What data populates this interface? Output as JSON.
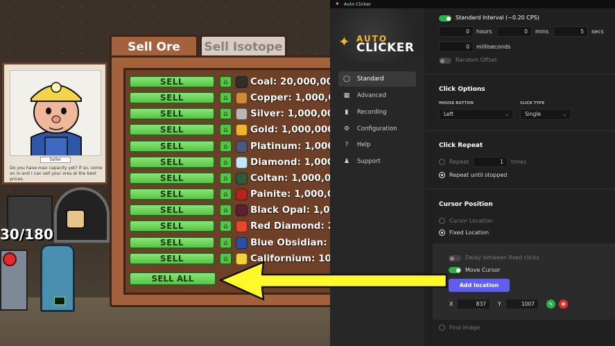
{
  "game": {
    "tabs": {
      "sell_ore": "Sell Ore",
      "sell_isotope": "Sell Isotope"
    },
    "seller": {
      "name": "Seller",
      "dialog": "Do you have max capacity yet? If so, come on in and I can sell your ores at the best prices."
    },
    "sell_label": "SELL",
    "sell_all_label": "SELL ALL",
    "capacity": "30/180",
    "ores": [
      {
        "name": "Coal: 20,000,00",
        "color": "#2f2f2f"
      },
      {
        "name": "Copper: 1,000,0",
        "color": "#d08a3c"
      },
      {
        "name": "Silver: 1,000,00",
        "color": "#b7b7b7"
      },
      {
        "name": "Gold: 1,000,000",
        "color": "#f0b42a"
      },
      {
        "name": "Platinum: 1,000",
        "color": "#4a5a78"
      },
      {
        "name": "Diamond: 1,000",
        "color": "#bfe8f5"
      },
      {
        "name": "Coltan: 1,000,0",
        "color": "#2f5b3a"
      },
      {
        "name": "Painite: 1,000,0",
        "color": "#b3261e"
      },
      {
        "name": "Black Opal: 1,0",
        "color": "#5a2230"
      },
      {
        "name": "Red Diamond: 2",
        "color": "#e3482a"
      },
      {
        "name": "Blue Obsidian: 1",
        "color": "#2d4fa0"
      },
      {
        "name": "Californium: 10,",
        "color": "#f1d43a"
      }
    ]
  },
  "autoclicker": {
    "window_title": "Auto Clicker",
    "logo": {
      "line1": "AUTO",
      "line2": "CLICKER"
    },
    "nav": [
      {
        "label": "Standard",
        "icon": "mouse-icon"
      },
      {
        "label": "Advanced",
        "icon": "grid-icon"
      },
      {
        "label": "Recording",
        "icon": "camera-icon"
      },
      {
        "label": "Configuration",
        "icon": "gear-icon"
      },
      {
        "label": "Help",
        "icon": "question-icon"
      },
      {
        "label": "Support",
        "icon": "user-icon"
      }
    ],
    "interval": {
      "toggle_label": "Standard Interval (~0.20 CPS)",
      "hours": "0",
      "hours_label": "hours",
      "mins": "0",
      "mins_label": "mins",
      "secs": "5",
      "secs_label": "secs",
      "ms": "0",
      "ms_label": "milliseconds",
      "random_offset": "Random Offset"
    },
    "click_options": {
      "title": "Click Options",
      "mouse_button_label": "MOUSE BUTTON",
      "mouse_button_value": "Left",
      "click_type_label": "CLICK TYPE",
      "click_type_value": "Single"
    },
    "click_repeat": {
      "title": "Click Repeat",
      "repeat_label": "Repeat",
      "repeat_value": "1",
      "times_label": "times",
      "until_stopped": "Repeat until stopped"
    },
    "cursor_position": {
      "title": "Cursor Position",
      "cursor_location": "Cursor Location",
      "fixed_location": "Fixed Location",
      "delay_label": "Delay between fixed clicks",
      "move_cursor": "Move Cursor",
      "add_location": "Add location",
      "x_label": "X",
      "x_value": "837",
      "y_label": "Y",
      "y_value": "1007",
      "find_image": "Find Image"
    }
  }
}
